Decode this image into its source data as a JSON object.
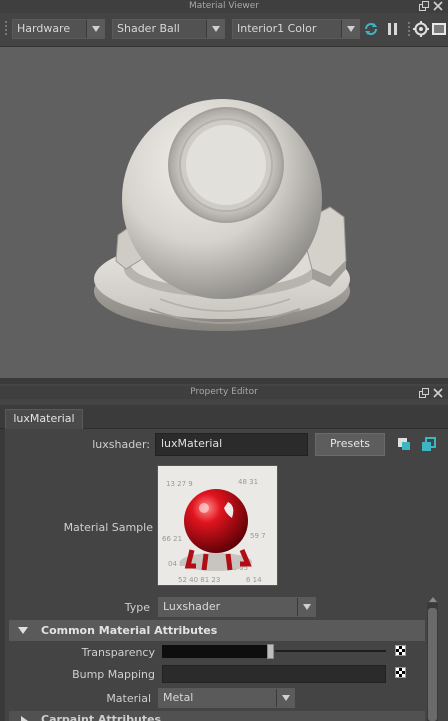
{
  "material_viewer": {
    "title": "Material Viewer",
    "renderer": "Hardware",
    "geometry": "Shader Ball",
    "environment": "Interior1 Color"
  },
  "property_editor": {
    "title": "Property Editor",
    "tab_label": "luxMaterial",
    "node_type_label": "luxshader:",
    "node_name": "luxMaterial",
    "presets_label": "Presets",
    "material_sample_label": "Material Sample",
    "type_label": "Type",
    "type_value": "Luxshader",
    "section_common": "Common Material Attributes",
    "transparency_label": "Transparency",
    "transparency_value": 0.47,
    "bump_label": "Bump Mapping",
    "material_label": "Material",
    "material_value": "Metal",
    "section_next": "Carpaint Attributes"
  },
  "colors": {
    "accent_red": "#c8101a",
    "panel_bg": "#444444",
    "viewport_bg": "#606060",
    "teal_icon": "#3db6c2"
  }
}
